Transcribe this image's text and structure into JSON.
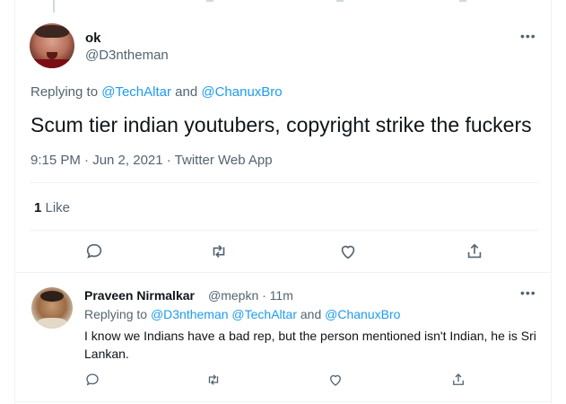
{
  "main_tweet": {
    "display_name": "ok",
    "handle": "@D3ntheman",
    "more_icon": "•••",
    "replying_prefix": "Replying to ",
    "reply_to_1": "@TechAltar",
    "reply_and": " and ",
    "reply_to_2": "@ChanuxBro",
    "text": "Scum tier indian youtubers, copyright strike the fuckers",
    "timestamp": "9:15 PM · Jun 2, 2021 · Twitter Web App",
    "likes_count": "1",
    "likes_label": " Like",
    "actions": [
      "reply-icon",
      "retweet-icon",
      "like-icon",
      "share-icon"
    ]
  },
  "reply_tweet": {
    "display_name": "Praveen Nirmalkar",
    "handle_time": "@mepkn · 11m",
    "more_icon": "•••",
    "replying_prefix": "Replying to ",
    "reply_to_1": "@D3ntheman",
    "reply_to_2": "@TechAltar",
    "reply_and": " and ",
    "reply_to_3": "@ChanuxBro",
    "text": "I know we Indians have a bad rep, but the person mentioned isn't Indian, he is Sri Lankan.",
    "actions": [
      "reply-icon",
      "retweet-icon",
      "like-icon",
      "share-icon"
    ]
  },
  "colors": {
    "link": "#1d9bf0",
    "secondary_text": "#536471",
    "primary_text": "#0f1419",
    "divider": "#eff3f4"
  }
}
